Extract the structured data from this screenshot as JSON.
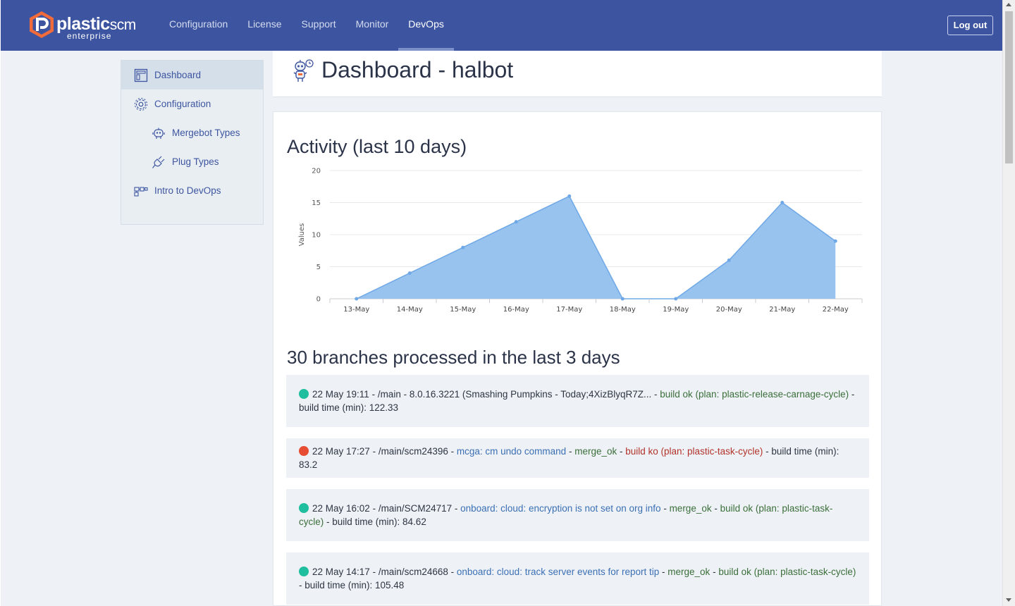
{
  "brand": {
    "name": "plastic",
    "name_suffix": "scm",
    "edition": "enterprise"
  },
  "nav": {
    "items": [
      {
        "label": "Configuration",
        "active": false
      },
      {
        "label": "License",
        "active": false
      },
      {
        "label": "Support",
        "active": false
      },
      {
        "label": "Monitor",
        "active": false
      },
      {
        "label": "DevOps",
        "active": true
      }
    ],
    "logout_label": "Log out"
  },
  "sidebar": {
    "items": [
      {
        "label": "Dashboard",
        "icon": "dashboard-icon",
        "active": true
      },
      {
        "label": "Configuration",
        "icon": "gear-icon",
        "active": false
      },
      {
        "label": "Mergebot Types",
        "icon": "robot-icon",
        "active": false
      },
      {
        "label": "Plug Types",
        "icon": "plug-icon",
        "active": false
      },
      {
        "label": "Intro to DevOps",
        "icon": "flow-icon",
        "active": false
      }
    ]
  },
  "header": {
    "title": "Dashboard - halbot",
    "icon": "robot-icon"
  },
  "activity": {
    "title": "Activity (last 10 days)"
  },
  "chart_data": {
    "type": "area",
    "title": "Activity (last 10 days)",
    "categories": [
      "13-May",
      "14-May",
      "15-May",
      "16-May",
      "17-May",
      "18-May",
      "19-May",
      "20-May",
      "21-May",
      "22-May"
    ],
    "values": [
      0,
      4,
      8,
      12,
      16,
      0,
      0,
      6,
      15,
      9
    ],
    "ylabel": "Values",
    "ylim": [
      0,
      20
    ],
    "yticks": [
      0,
      5,
      10,
      15,
      20
    ],
    "grid": true,
    "fill_color": "#99c3ef",
    "line_color": "#6fa8e6"
  },
  "branches": {
    "title": "30 branches processed in the last 3 days",
    "items": [
      {
        "status": "ok",
        "date": "22 May 19:11",
        "sep1": " - ",
        "branch": "/main",
        "sep2": " - ",
        "desc": "8.0.16.3221 (Smashing Pumpkins - Today;4XizBlyqR7Z...",
        "sep3": " - ",
        "merge": "",
        "sep4": "",
        "build": "build ok (plan: plastic-release-carnage-cycle)",
        "sep5": " - ",
        "build_time": "build time (min): 122.33"
      },
      {
        "status": "ko",
        "date": "22 May 17:27",
        "sep1": " - ",
        "branch": "/main/scm24396",
        "sep2": " - ",
        "desc": "mcga: cm undo command",
        "sep3": " - ",
        "merge": "merge_ok",
        "sep4": " - ",
        "build": "build ko (plan: plastic-task-cycle)",
        "sep5": " - ",
        "build_time": "build time (min): 83.2"
      },
      {
        "status": "ok",
        "date": "22 May 16:02",
        "sep1": " - ",
        "branch": "/main/SCM24717",
        "sep2": " - ",
        "desc": "onboard: cloud: encryption is not set on org info",
        "sep3": " - ",
        "merge": "merge_ok",
        "sep4": " - ",
        "build": "build ok (plan: plastic-task-cycle)",
        "sep5": " - ",
        "build_time": "build time (min): 84.62"
      },
      {
        "status": "ok",
        "date": "22 May 14:17",
        "sep1": " - ",
        "branch": "/main/scm24668",
        "sep2": " - ",
        "desc": "onboard: cloud: track server events for report tip",
        "sep3": " - ",
        "merge": "merge_ok",
        "sep4": " - ",
        "build": "build ok (plan: plastic-task-cycle)",
        "sep5": " - ",
        "build_time": "build time (min): 105.48"
      }
    ]
  }
}
